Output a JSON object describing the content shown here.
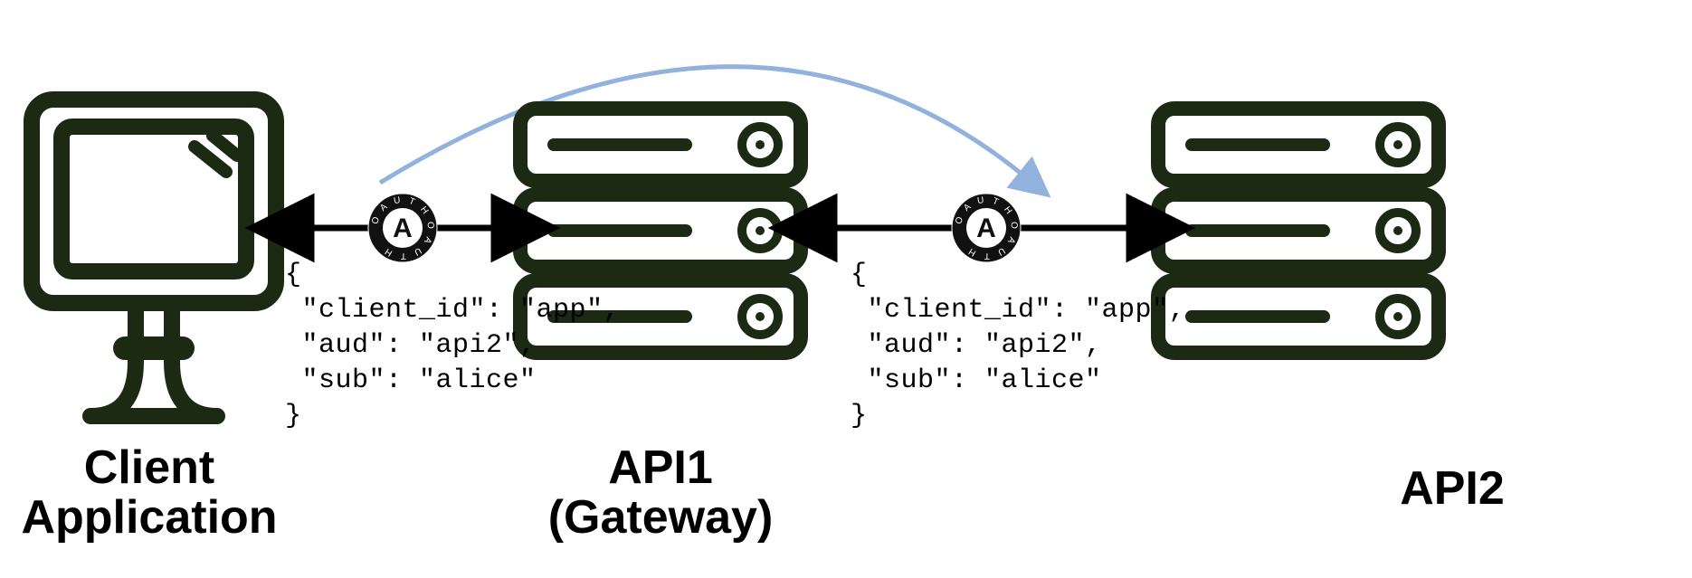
{
  "nodes": {
    "client": {
      "label": "Client Application"
    },
    "api1": {
      "label": "API1\n(Gateway)"
    },
    "api2": {
      "label": "API2"
    }
  },
  "tokens": {
    "t1": {
      "client_id": "app",
      "aud": "api2",
      "sub": "alice"
    },
    "t2": {
      "client_id": "app",
      "aud": "api2",
      "sub": "alice"
    }
  },
  "oauth_badge_text": "OAUTH",
  "colors": {
    "stroke": "#1c2a14",
    "arc": "#92b2de",
    "badge_bg": "#111111",
    "badge_fg": "#ffffff"
  }
}
